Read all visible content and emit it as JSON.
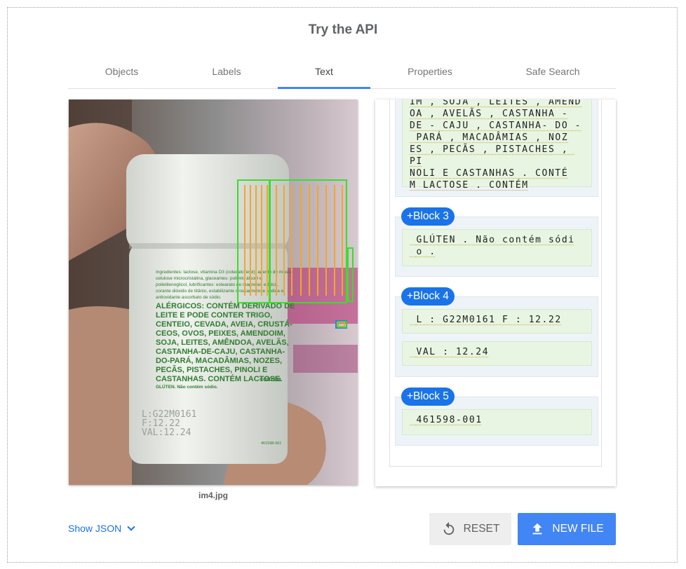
{
  "title": "Try the API",
  "tabs": [
    {
      "label": "Objects"
    },
    {
      "label": "Labels"
    },
    {
      "label": "Text",
      "active": true
    },
    {
      "label": "Properties"
    },
    {
      "label": "Safe Search"
    }
  ],
  "image": {
    "caption": "im4.jpg",
    "label_text": {
      "ingredients_header": "Ingredientes: lactose, vitamina D3 (colecalciferol), agente de massa",
      "ingredients_line2": "celulose microcristalina, glaceantes: polivinil álcool e",
      "ingredients_line3": "polietilenoglicol, lubrificantes: estearato de magnésio e talco,",
      "ingredients_line4": "corante dióxido de titânio, estabilizante croscarmelose sódica e",
      "ingredients_line5": "antioxidante ascorbato de sódio.",
      "allergens": [
        "ALÉRGICOS: CONTÉM DERIVADO DE",
        "LEITE E PODE CONTER TRIGO,",
        "CENTEIO, CEVADA, AVEIA, CRUSTÁ-",
        "CEOS, OVOS, PEIXES, AMENDOIM,",
        "SOJA, LEITES, AMÊNDOA, AVELÃS,",
        "CASTANHA-DE-CAJU, CASTANHA-",
        "DO-PARÁ, MACADÂMIAS, NOZES,",
        "PECÃS, PISTACHES, PINOLI E",
        "CASTANHAS. CONTÉM LACTOSE."
      ],
      "allergens_suffix": "CONTÉM",
      "gluten": "GLÚTEN. Não contém sódio.",
      "lot_lines": [
        "L:G22M0161",
        "F:12.22",
        "VAL:12.24"
      ],
      "code": "461598-001"
    }
  },
  "results": {
    "block2_lines": [
      "IM , SOJA , LEITES , AMEND",
      "OA , AVELÃS , CASTANHA -",
      "DE - CAJU , CASTANHA- DO -",
      " PARÁ , MACADÂMIAS , NOZ",
      "ES , PECÃS , PISTACHES , PI",
      "NOLI E CASTANHAS . CONTÉ",
      "M LACTOSE . CONTÉM"
    ],
    "block3": {
      "label": "+Block 3",
      "paragraphs": [
        " GLÚTEN . Não contém sódi\n o ."
      ]
    },
    "block4": {
      "label": "+Block 4",
      "paragraphs": [
        " L : G22M0161 F : 12.22",
        " VAL : 12.24"
      ]
    },
    "block5": {
      "label": "+Block 5",
      "paragraphs": [
        " 461598-001"
      ]
    }
  },
  "footer": {
    "show_json": "Show JSON",
    "reset": "RESET",
    "new_file": "NEW FILE"
  },
  "colors": {
    "accent": "#4285f4",
    "badge": "#1a73e8",
    "block_bg": "#eef3f8",
    "para_bg": "#e8f5e2",
    "detect_green": "#3ddc2b",
    "detect_orange": "#f5a623"
  }
}
